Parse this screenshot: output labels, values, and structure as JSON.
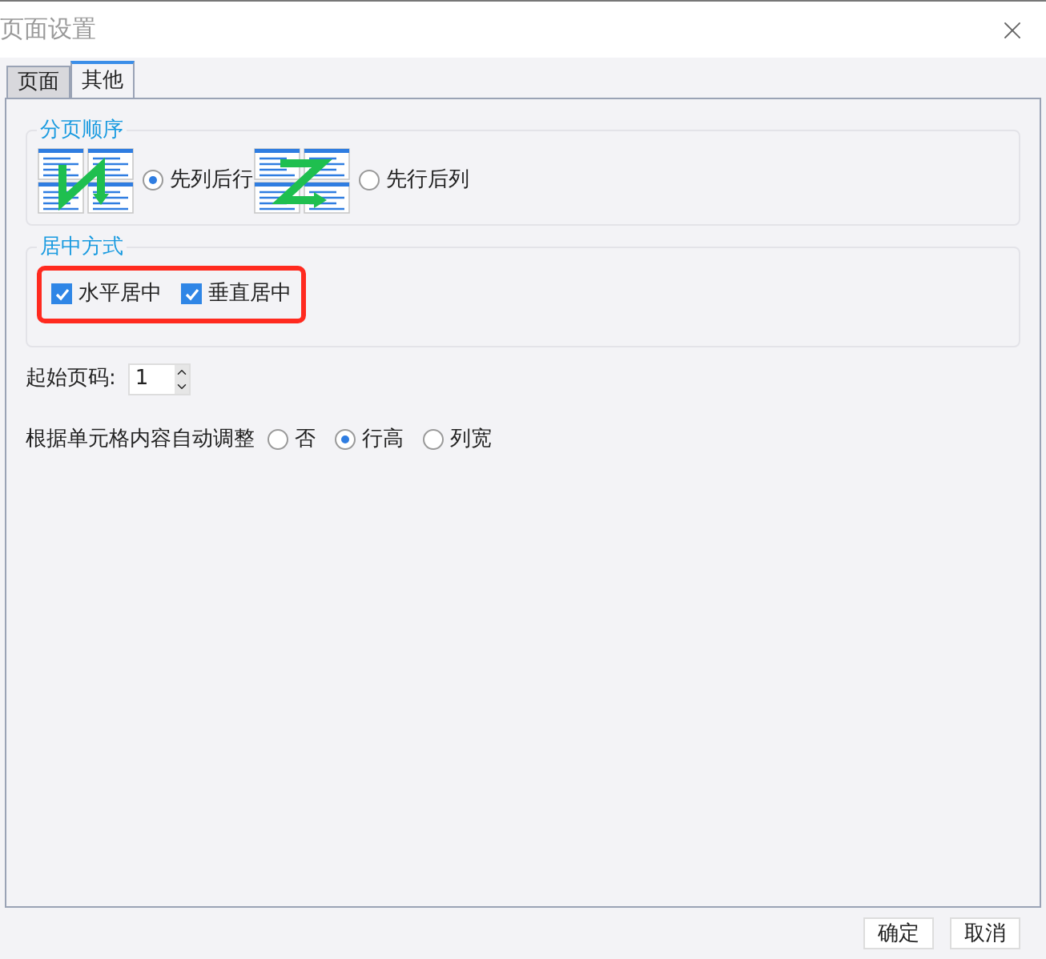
{
  "window": {
    "title": "页面设置"
  },
  "tabs": [
    {
      "label": "页面",
      "selected": false
    },
    {
      "label": "其他",
      "selected": true
    }
  ],
  "page_order": {
    "title": "分页顺序",
    "options": [
      {
        "label": "先列后行",
        "selected": true,
        "kind": "down-then-over"
      },
      {
        "label": "先行后列",
        "selected": false,
        "kind": "over-then-down"
      }
    ]
  },
  "centering": {
    "title": "居中方式",
    "options": [
      {
        "label": "水平居中",
        "checked": true
      },
      {
        "label": "垂直居中",
        "checked": true
      }
    ]
  },
  "start_page": {
    "label": "起始页码:",
    "value": "1"
  },
  "autofit": {
    "label": "根据单元格内容自动调整",
    "options": [
      {
        "label": "否",
        "selected": false
      },
      {
        "label": "行高",
        "selected": true
      },
      {
        "label": "列宽",
        "selected": false
      }
    ]
  },
  "buttons": [
    "确定",
    "取消"
  ]
}
